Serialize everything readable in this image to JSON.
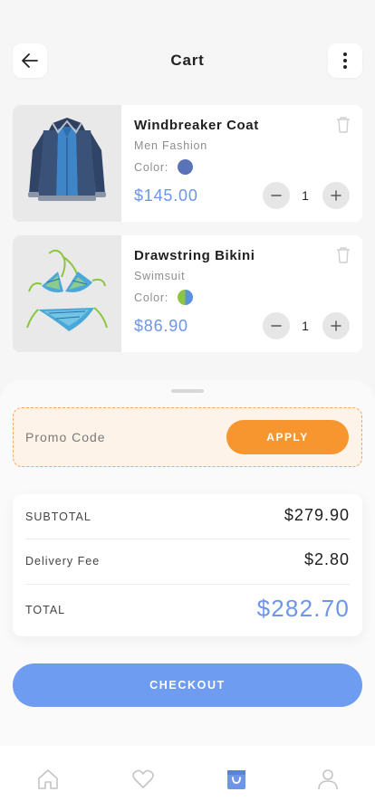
{
  "header": {
    "title": "Cart",
    "back_icon": "arrow-left-icon",
    "menu_icon": "more-vertical-icon"
  },
  "cart_items": [
    {
      "name": "Windbreaker Coat",
      "category": "Men Fashion",
      "color_label": "Color:",
      "color": "#5a72b8",
      "price": "$145.00",
      "quantity": "1",
      "image": "jacket-image"
    },
    {
      "name": "Drawstring Bikini",
      "category": "Swimsuit",
      "color_label": "Color:",
      "color_split": [
        "#8cc63f",
        "#5b8fe0"
      ],
      "price": "$86.90",
      "quantity": "1",
      "image": "bikini-image"
    }
  ],
  "promo": {
    "placeholder": "Promo Code",
    "apply_label": "APPLY"
  },
  "summary": {
    "subtotal_label": "SUBTOTAL",
    "subtotal_value": "$279.90",
    "delivery_label": "Delivery Fee",
    "delivery_value": "$2.80",
    "total_label": "TOTAL",
    "total_value": "$282.70"
  },
  "checkout_label": "CHECKOUT",
  "bottom_nav": {
    "items": [
      "home-icon",
      "heart-icon",
      "shopping-bag-icon",
      "user-icon"
    ],
    "active": "shopping-bag-icon"
  },
  "colors": {
    "accent_blue": "#6d95e8",
    "accent_orange": "#f7962e",
    "promo_bg": "#fdf3e8"
  }
}
